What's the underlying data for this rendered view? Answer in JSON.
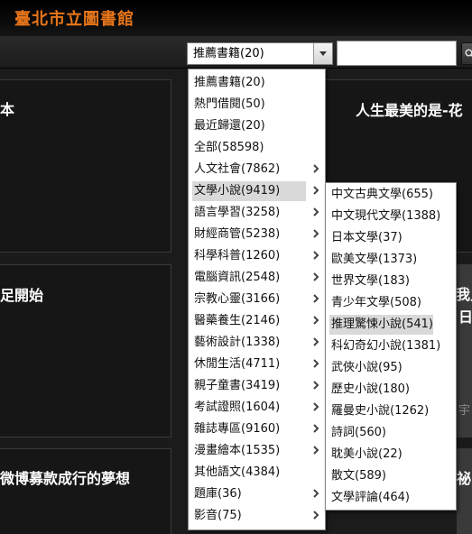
{
  "header": {
    "title": "臺北市立圖書館"
  },
  "toolbar": {
    "category_select": {
      "value": "推薦書籍(20)"
    },
    "search_input": {
      "value": ""
    }
  },
  "cards": [
    {
      "title": "本"
    },
    {
      "title": "人生最美的是-花"
    },
    {
      "title": "足開始"
    },
    {
      "title": "微博募款成行的夢想"
    }
  ],
  "right_side": {
    "fragment_1": "我只",
    "fragment_2": "日",
    "fragment_3": "宇",
    "fragment_4": "祕"
  },
  "main_menu": {
    "items": [
      {
        "label": "推薦書籍(20)",
        "has_submenu": false
      },
      {
        "label": "熱門借閱(50)",
        "has_submenu": false
      },
      {
        "label": "最近歸還(20)",
        "has_submenu": false
      },
      {
        "label": "全部(58598)",
        "has_submenu": false
      },
      {
        "label": "人文社會(7862)",
        "has_submenu": true
      },
      {
        "label": "文學小說(9419)",
        "has_submenu": true,
        "active": true
      },
      {
        "label": "語言學習(3258)",
        "has_submenu": true
      },
      {
        "label": "財經商管(5238)",
        "has_submenu": true
      },
      {
        "label": "科學科普(1260)",
        "has_submenu": true
      },
      {
        "label": "電腦資訊(2548)",
        "has_submenu": true
      },
      {
        "label": "宗教心靈(3166)",
        "has_submenu": true
      },
      {
        "label": "醫藥養生(2146)",
        "has_submenu": true
      },
      {
        "label": "藝術設計(1338)",
        "has_submenu": true
      },
      {
        "label": "休閒生活(4711)",
        "has_submenu": true
      },
      {
        "label": "親子童書(3419)",
        "has_submenu": true
      },
      {
        "label": "考試證照(1604)",
        "has_submenu": true
      },
      {
        "label": "雜誌專區(9160)",
        "has_submenu": true
      },
      {
        "label": "漫畫繪本(1535)",
        "has_submenu": true
      },
      {
        "label": "其他語文(4384)",
        "has_submenu": false
      },
      {
        "label": "題庫(36)",
        "has_submenu": true
      },
      {
        "label": "影音(75)",
        "has_submenu": true
      }
    ]
  },
  "sub_menu": {
    "items": [
      {
        "label": "中文古典文學(655)"
      },
      {
        "label": "中文現代文學(1388)"
      },
      {
        "label": "日本文學(37)"
      },
      {
        "label": "歐美文學(1373)"
      },
      {
        "label": "世界文學(183)"
      },
      {
        "label": "青少年文學(508)"
      },
      {
        "label": "推理驚悚小說(541)",
        "active": true
      },
      {
        "label": "科幻奇幻小說(1381)"
      },
      {
        "label": "武俠小說(95)"
      },
      {
        "label": "歷史小說(180)"
      },
      {
        "label": "羅曼史小說(1262)"
      },
      {
        "label": "詩詞(560)"
      },
      {
        "label": "耽美小說(22)"
      },
      {
        "label": "散文(589)"
      },
      {
        "label": "文學評論(464)"
      }
    ]
  },
  "colors": {
    "brand": "#e8761a",
    "background": "#1b1b1b",
    "menu_highlight": "#d9d9d9"
  }
}
